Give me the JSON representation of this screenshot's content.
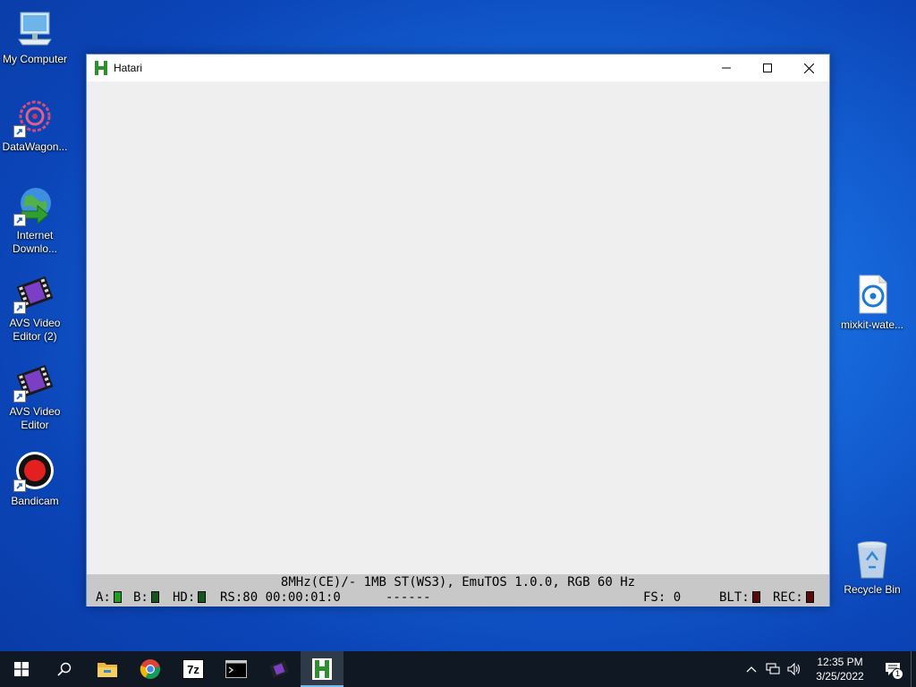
{
  "desktop": {
    "icons": [
      {
        "label": "My Computer"
      },
      {
        "label": "DataWagon..."
      },
      {
        "label": "Internet Downlo..."
      },
      {
        "label": "AVS Video Editor (2)"
      },
      {
        "label": "AVS Video Editor"
      },
      {
        "label": "Bandicam"
      },
      {
        "label": "mixkit-wate..."
      },
      {
        "label": "Recycle Bin"
      }
    ]
  },
  "window": {
    "title": "Hatari",
    "app_icon_letter": "H",
    "status": {
      "line1": "8MHz(CE)/- 1MB ST(WS3), EmuTOS 1.0.0, RGB 60 Hz",
      "drive_a": "A:",
      "drive_b": "B:",
      "hd": "HD:",
      "rs": "RS:80 00:00:01:0",
      "dashes": "------",
      "fs": "FS: 0",
      "blt": "BLT:",
      "rec": "REC:"
    }
  },
  "taskbar": {
    "apps": [
      "start-icon",
      "search-icon",
      "file-explorer-icon",
      "chrome-icon",
      "7zip-icon",
      "terminal-icon",
      "avs-video-icon",
      "hatari-icon"
    ],
    "sevenzip_text": "7z",
    "clock_time": "12:35 PM",
    "clock_date": "3/25/2022",
    "notification_count": "1"
  },
  "colors": {
    "led_green": "#1aa31a",
    "led_dark_green": "#0f5a1a",
    "led_dark_red": "#5a0a0a",
    "hatari_green": "#2f8f2f"
  }
}
